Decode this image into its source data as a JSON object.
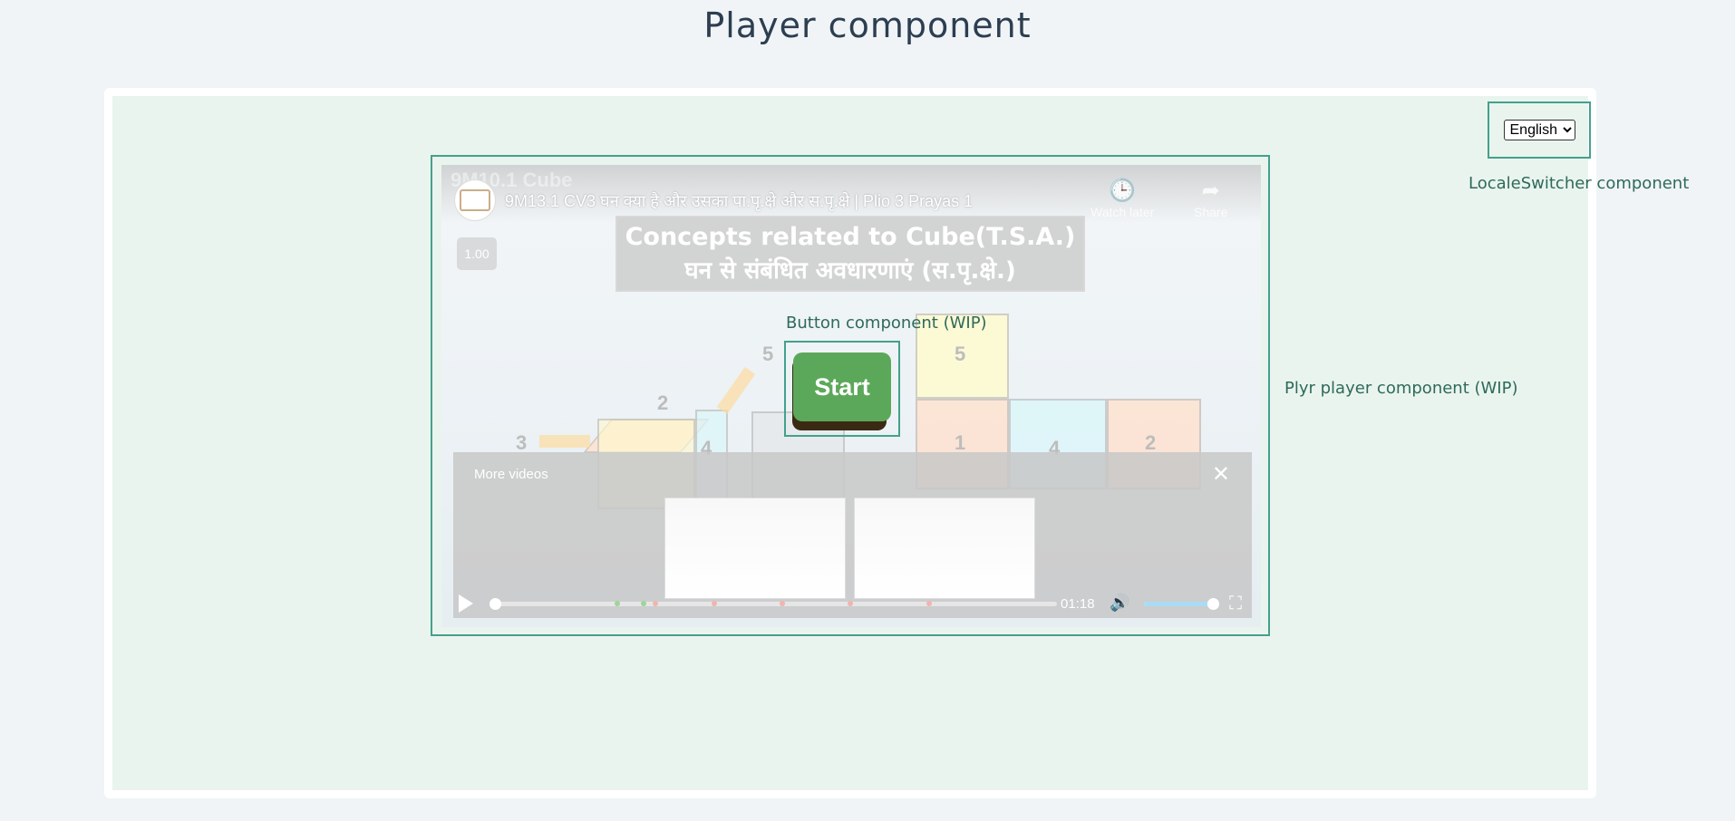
{
  "page": {
    "title": "Player component"
  },
  "locale_switcher": {
    "selected": "English",
    "options": [
      "English"
    ],
    "label": "LocaleSwitcher component"
  },
  "player_component": {
    "label": "Plyr player component (WIP)",
    "video": {
      "ghost_heading": "9M10.1 Cube",
      "title": "9M13.1 CV3 घन क्या है और उसका पा.पृ.क्षे और स.पृ.क्षे | Plio 3 Prayas 1",
      "watch_later_label": "Watch later",
      "share_label": "Share",
      "speed": "1.00",
      "slide_title_line1": "Concepts related to Cube(T.S.A.)",
      "slide_title_line2": "घन से संबंधित अवधारणाएं (स.पृ.क्षे.)",
      "more_videos_label": "More videos",
      "time": "01:18",
      "progress": 0.0,
      "volume": 0.92
    }
  },
  "button_component": {
    "label": "Button component (WIP)",
    "start_label": "Start"
  },
  "colors": {
    "accent_border": "#44a08d",
    "start_button": "#5ca85a",
    "label_text": "#2e6a5b"
  }
}
